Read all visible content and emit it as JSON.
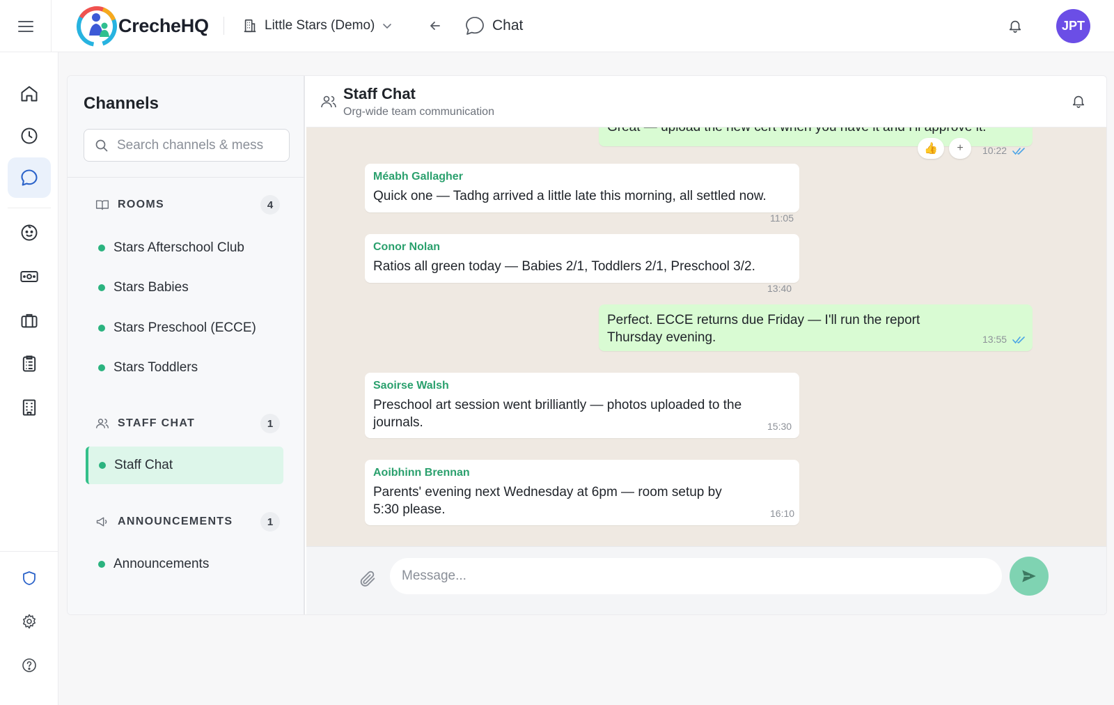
{
  "app": {
    "brand": "CrecheHQ",
    "org_name": "Little Stars (Demo)",
    "breadcrumb": "Chat",
    "avatar_initials": "JPT"
  },
  "channels": {
    "title": "Channels",
    "search_placeholder": "Search channels & messages",
    "sections": [
      {
        "label": "ROOMS",
        "count": "4",
        "icon": "book-icon",
        "items": [
          "Stars Afterschool Club",
          "Stars Babies",
          "Stars Preschool (ECCE)",
          "Stars Toddlers"
        ]
      },
      {
        "label": "STAFF CHAT",
        "count": "1",
        "icon": "users-icon",
        "items": [
          "Staff Chat"
        ],
        "active_item": "Staff Chat"
      },
      {
        "label": "ANNOUNCEMENTS",
        "count": "1",
        "icon": "megaphone-icon",
        "items": [
          "Announcements"
        ]
      }
    ]
  },
  "chat": {
    "title": "Staff Chat",
    "subtitle": "Org-wide team communication",
    "messages": [
      {
        "direction": "out",
        "text": "Great — upload the new cert when you have it and I'll approve it.",
        "time": "10:22",
        "read": true,
        "reactions": [
          "👍",
          "+"
        ]
      },
      {
        "direction": "in",
        "sender": "Méabh Gallagher",
        "text": "Quick one — Tadhg arrived a little late this morning, all settled now.",
        "time": "11:05"
      },
      {
        "direction": "in",
        "sender": "Conor Nolan",
        "text": "Ratios all green today — Babies 2/1, Toddlers 2/1, Preschool 3/2.",
        "time": "13:40"
      },
      {
        "direction": "out",
        "text": "Perfect. ECCE returns due Friday — I'll run the report Thursday evening.",
        "time": "13:55",
        "read": true
      },
      {
        "direction": "in",
        "sender": "Saoirse Walsh",
        "text": "Preschool art session went brilliantly — photos uploaded to the journals.",
        "time": "15:30"
      },
      {
        "direction": "in",
        "sender": "Aoibhinn Brennan",
        "text": "Parents' evening next Wednesday at 6pm — room setup by 5:30 please.",
        "time": "16:10"
      }
    ],
    "composer_placeholder": "Message..."
  },
  "colors": {
    "accent_green": "#2aa06d",
    "outgoing_bubble": "#d9fbd3",
    "chat_background": "#efe9e2",
    "avatar": "#6b4ee6",
    "send_button": "#7fd3b2",
    "active_channel": "#ddf6ea"
  },
  "rail_icons": [
    "home-icon",
    "clock-icon",
    "chat-icon",
    "child-face-icon",
    "money-icon",
    "briefcase-icon",
    "clipboard-icon",
    "building-icon",
    "shield-icon",
    "gear-icon",
    "help-icon"
  ]
}
